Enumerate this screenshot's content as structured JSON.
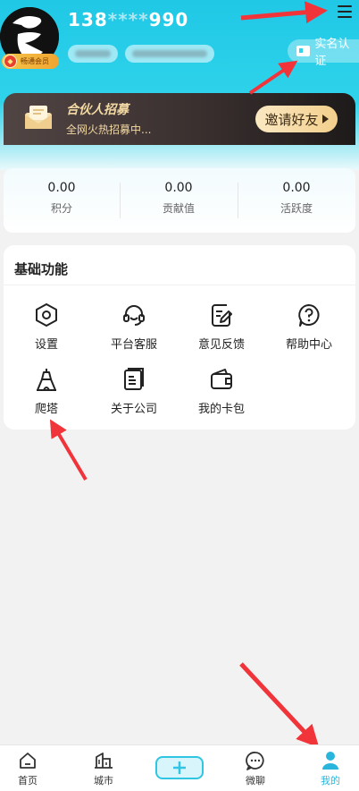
{
  "profile": {
    "phone_prefix": "138",
    "phone_mask": "****",
    "phone_suffix": "990",
    "vip_label": "畅通会员",
    "verify_label": "实名认证"
  },
  "banner": {
    "title": "合伙人招募",
    "subtitle": "全网火热招募中...",
    "invite_label": "邀请好友"
  },
  "stats": [
    {
      "value": "0.00",
      "label": "积分"
    },
    {
      "value": "0.00",
      "label": "贡献值"
    },
    {
      "value": "0.00",
      "label": "活跃度"
    }
  ],
  "functions": {
    "title": "基础功能",
    "items": [
      {
        "label": "设置",
        "icon": "settings-icon"
      },
      {
        "label": "平台客服",
        "icon": "headset-icon"
      },
      {
        "label": "意见反馈",
        "icon": "feedback-icon"
      },
      {
        "label": "帮助中心",
        "icon": "help-icon"
      },
      {
        "label": "爬塔",
        "icon": "tower-icon"
      },
      {
        "label": "关于公司",
        "icon": "document-icon"
      },
      {
        "label": "我的卡包",
        "icon": "wallet-icon"
      }
    ]
  },
  "tabbar": {
    "items": [
      {
        "label": "首页",
        "icon": "home-icon"
      },
      {
        "label": "城市",
        "icon": "city-icon"
      },
      {
        "label": "微聊",
        "icon": "chat-icon"
      },
      {
        "label": "我的",
        "icon": "user-icon"
      }
    ],
    "plus_icon": "plus-icon"
  },
  "colors": {
    "header": "#2fd3ea",
    "accent": "#2ab6dc",
    "annotation_arrow": "#f0343a",
    "banner_gold": "#f3d9a3"
  }
}
